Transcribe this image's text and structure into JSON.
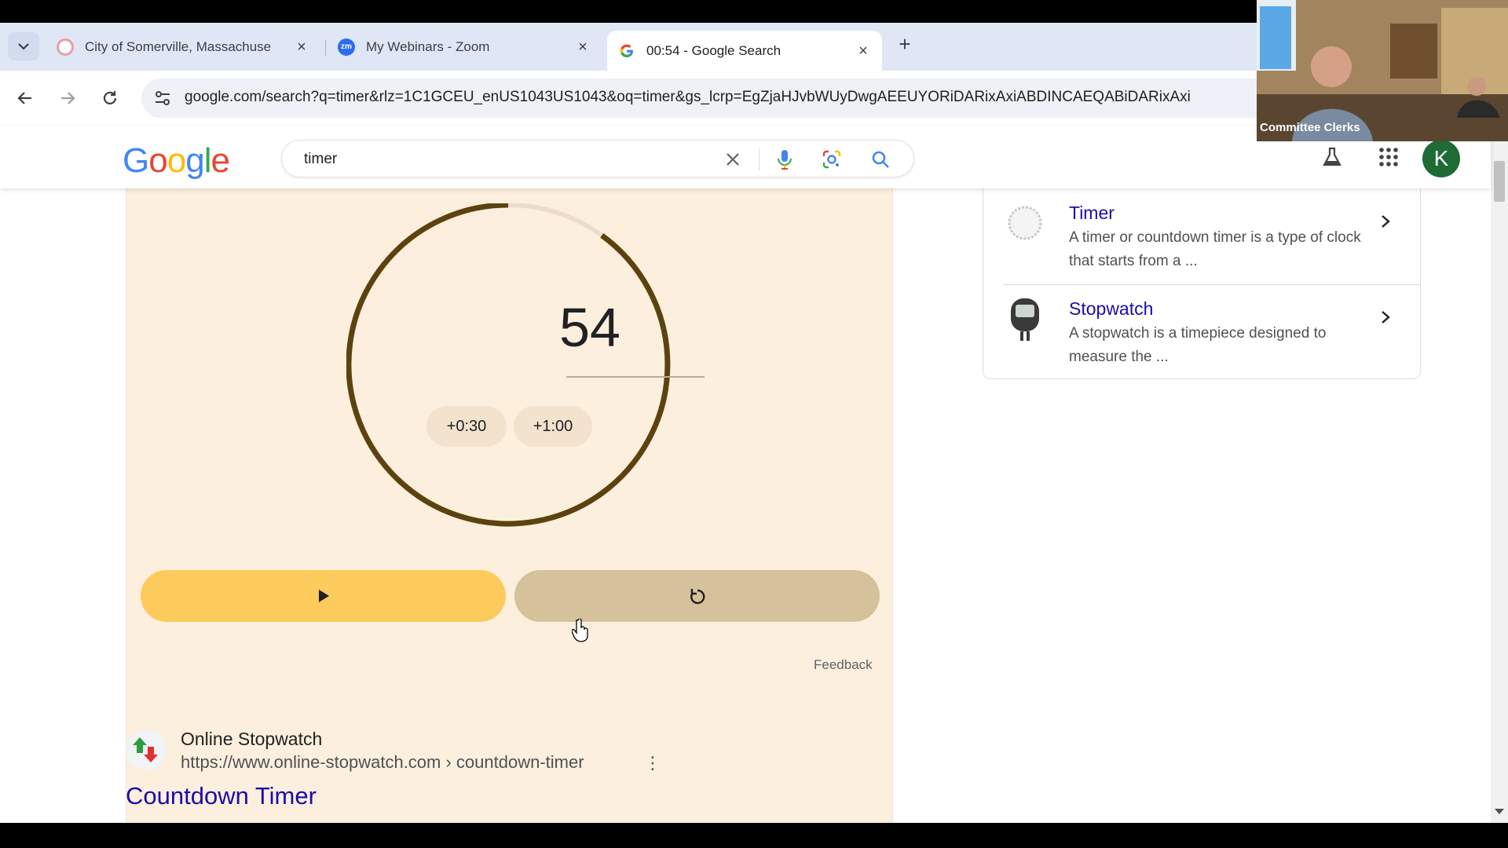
{
  "tabs": [
    {
      "title": "City of Somerville, Massachuse",
      "active": false
    },
    {
      "title": "My Webinars - Zoom",
      "active": false
    },
    {
      "title": "00:54 - Google Search",
      "active": true
    }
  ],
  "zoom_favicon": "zm",
  "address": {
    "url": "google.com/search?q=timer&rlz=1C1GCEU_enUS1043US1043&oq=timer&gs_lcrp=EgZjaHJvbWUyDwgAEEUYORiDARixAxiABDINCAEQABiDARixAxi"
  },
  "google": {
    "logo_letters": [
      "G",
      "o",
      "o",
      "g",
      "l",
      "e"
    ],
    "logo_colors": [
      "#4285f4",
      "#ea4335",
      "#fbbc05",
      "#4285f4",
      "#34a853",
      "#ea4335"
    ],
    "query": "timer",
    "avatar_letter": "K"
  },
  "timer": {
    "value": "54",
    "add_30": "+0:30",
    "add_60": "+1:00",
    "remaining_fraction": 0.9,
    "feedback": "Feedback"
  },
  "result": {
    "site_name": "Online Stopwatch",
    "site_url": "https://www.online-stopwatch.com › countdown-timer",
    "headline": "Countdown Timer"
  },
  "knowledge_panel": {
    "items": [
      {
        "title": "Timer",
        "desc": "A timer or countdown timer is a type of clock that starts from a ..."
      },
      {
        "title": "Stopwatch",
        "desc": "A stopwatch is a timepiece designed to measure the ..."
      }
    ]
  },
  "video": {
    "label": "Committee Clerks"
  },
  "colors": {
    "accent_start": "#fdca5c",
    "reset": "#d6c29a",
    "ring": "#5c420e",
    "link": "#1a0dab"
  }
}
